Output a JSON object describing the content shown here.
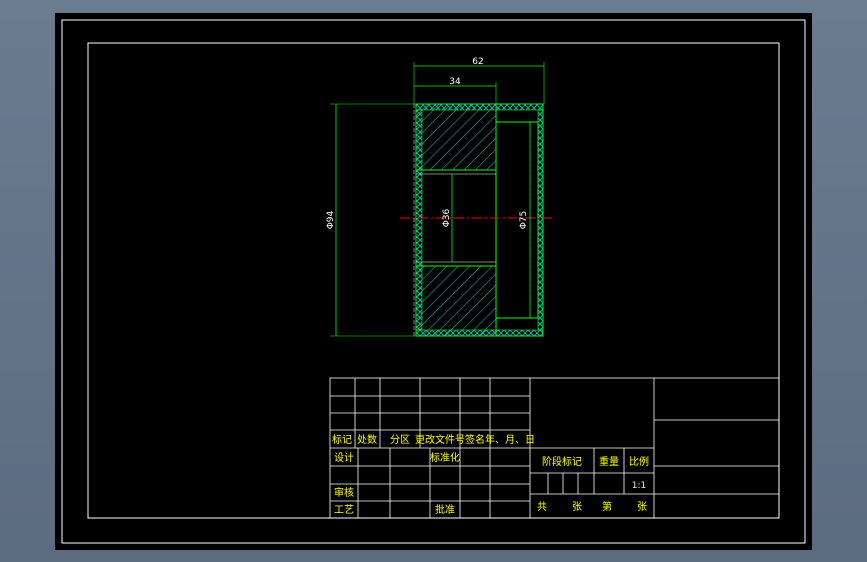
{
  "drawing": {
    "dimensions": {
      "overall_width": "62",
      "hub_width": "34",
      "outer_diameter": "Φ94",
      "bore_diameter": "Φ36",
      "recess_diameter": "Φ75"
    }
  },
  "title_block": {
    "row_labels": [
      "标记",
      "处数",
      "分区",
      "更改文件号",
      "签名",
      "年、月、日"
    ],
    "design": "设计",
    "standardization": "标准化",
    "review": "审核",
    "process": "工艺",
    "approve": "批准",
    "stage_mark": "阶段标记",
    "weight": "重量",
    "ratio": "比例",
    "scale": "1:1",
    "total": "共",
    "sheets": "张",
    "page": "第",
    "sheet": "张"
  },
  "colors": {
    "background": "#000000",
    "frame": "#ffffff",
    "outline": "#00ff00",
    "hatch": "#00cccc",
    "dimension": "#00ff00",
    "centerline": "#ff0000",
    "title_text": "#ffff00"
  }
}
